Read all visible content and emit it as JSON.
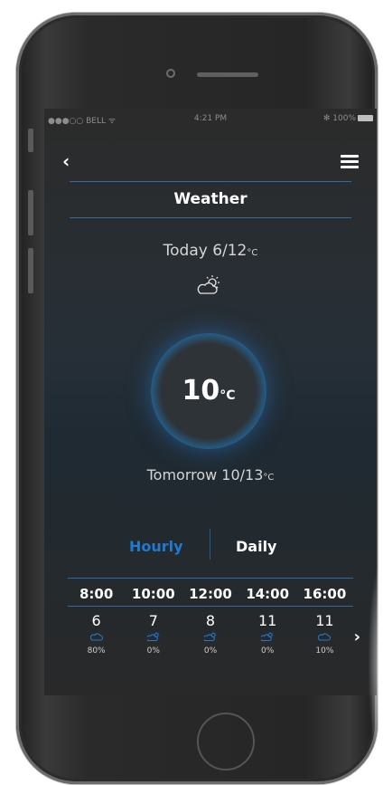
{
  "status_bar": {
    "carrier": "●●●○○ BELL ᯤ",
    "time": "4:21 PM",
    "battery": "✻ 100%"
  },
  "nav": {
    "back_icon": "chevron-left-icon",
    "back_glyph": "‹",
    "menu_icon": "hamburger-menu-icon",
    "title": "Weather"
  },
  "today": {
    "label": "Today 6/12",
    "unit": "°C",
    "icon": "partly-cloudy-icon"
  },
  "current": {
    "value": "10",
    "unit": "°C"
  },
  "tomorrow": {
    "label": "Tomorrow 10/13",
    "unit": "°C"
  },
  "tabs": {
    "hourly": "Hourly",
    "daily": "Daily",
    "active": "hourly"
  },
  "forecast": [
    {
      "time": "8:00",
      "temp": "6",
      "icon": "cloud-icon",
      "precip": "80%"
    },
    {
      "time": "10:00",
      "temp": "7",
      "icon": "partly-cloudy-icon",
      "precip": "0%"
    },
    {
      "time": "12:00",
      "temp": "8",
      "icon": "partly-cloudy-icon",
      "precip": "0%"
    },
    {
      "time": "14:00",
      "temp": "11",
      "icon": "partly-cloudy-icon",
      "precip": "0%"
    },
    {
      "time": "16:00",
      "temp": "11",
      "icon": "cloud-icon",
      "precip": "10%"
    }
  ],
  "next_icon": "chevron-right-icon",
  "next_glyph": "›",
  "colors": {
    "accent": "#1f7ad0",
    "ring": "#2f8ee0",
    "rule": "#2f6aa5"
  }
}
